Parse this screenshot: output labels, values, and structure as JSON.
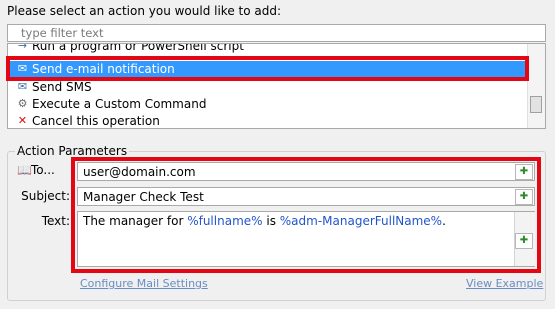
{
  "prompt": "Please select an action you would like to add:",
  "filter": {
    "placeholder": "type filter text"
  },
  "actions": [
    {
      "label": "Run a program or PowerShell script",
      "icon": "script-icon",
      "glyph": "→"
    },
    {
      "label": "Send e-mail notification",
      "icon": "email-icon",
      "glyph": "✉"
    },
    {
      "label": "Send SMS",
      "icon": "sms-icon",
      "glyph": "✉"
    },
    {
      "label": "Execute a Custom Command",
      "icon": "gear-icon",
      "glyph": "⚙"
    },
    {
      "label": "Cancel this operation",
      "icon": "cancel-icon",
      "glyph": "✕"
    }
  ],
  "selected_index": 1,
  "params": {
    "title": "Action Parameters",
    "to_label": "To...",
    "to_value": "user@domain.com",
    "subject_label": "Subject:",
    "subject_value": "Manager Check Test",
    "text_label": "Text:",
    "text_parts": [
      "The manager for ",
      "%fullname%",
      " is ",
      "%adm-ManagerFullName%",
      "."
    ]
  },
  "links": {
    "configure": "Configure Mail Settings",
    "view_example": "View Example"
  },
  "colors": {
    "selection": "#3399ff",
    "highlight_box": "#e30613",
    "link": "#6a8cc4",
    "value_token": "#2255cc"
  }
}
